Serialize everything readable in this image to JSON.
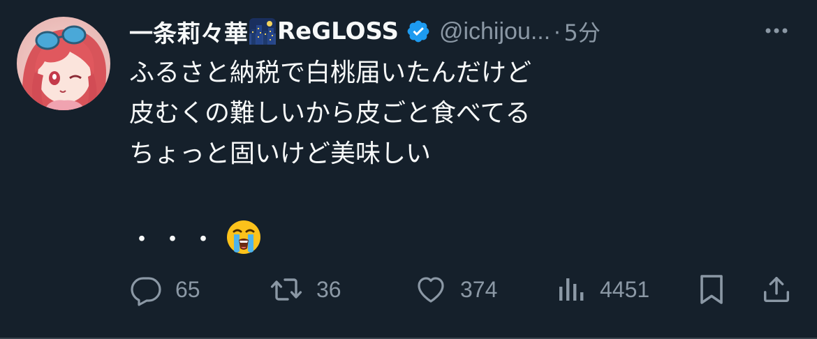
{
  "tweet": {
    "display_name": "一条莉々華",
    "name_emoji": "night-city-emoji",
    "name_suffix": "ReGLOSS",
    "verified_icon": "verified-badge-icon",
    "handle": "@ichijou...",
    "separator": "·",
    "timestamp": "5分",
    "text_lines": [
      "ふるさと納税で白桃届いたんだけど",
      "皮むくの難しいから皮ごと食べてる",
      "ちょっと固いけど美味しい"
    ],
    "trailing_dots": "・・・",
    "trailing_emoji": "loudly-crying-face-emoji"
  },
  "actions": {
    "reply": {
      "icon": "reply-icon",
      "count": "65"
    },
    "retweet": {
      "icon": "retweet-icon",
      "count": "36"
    },
    "like": {
      "icon": "heart-icon",
      "count": "374"
    },
    "views": {
      "icon": "views-bar-chart-icon",
      "count": "4451"
    },
    "bookmark": {
      "icon": "bookmark-icon"
    },
    "share": {
      "icon": "share-icon"
    }
  },
  "colors": {
    "background": "#15202b",
    "text": "#f7f9f9",
    "secondary": "#8b98a5",
    "verified": "#1d9bf0"
  }
}
